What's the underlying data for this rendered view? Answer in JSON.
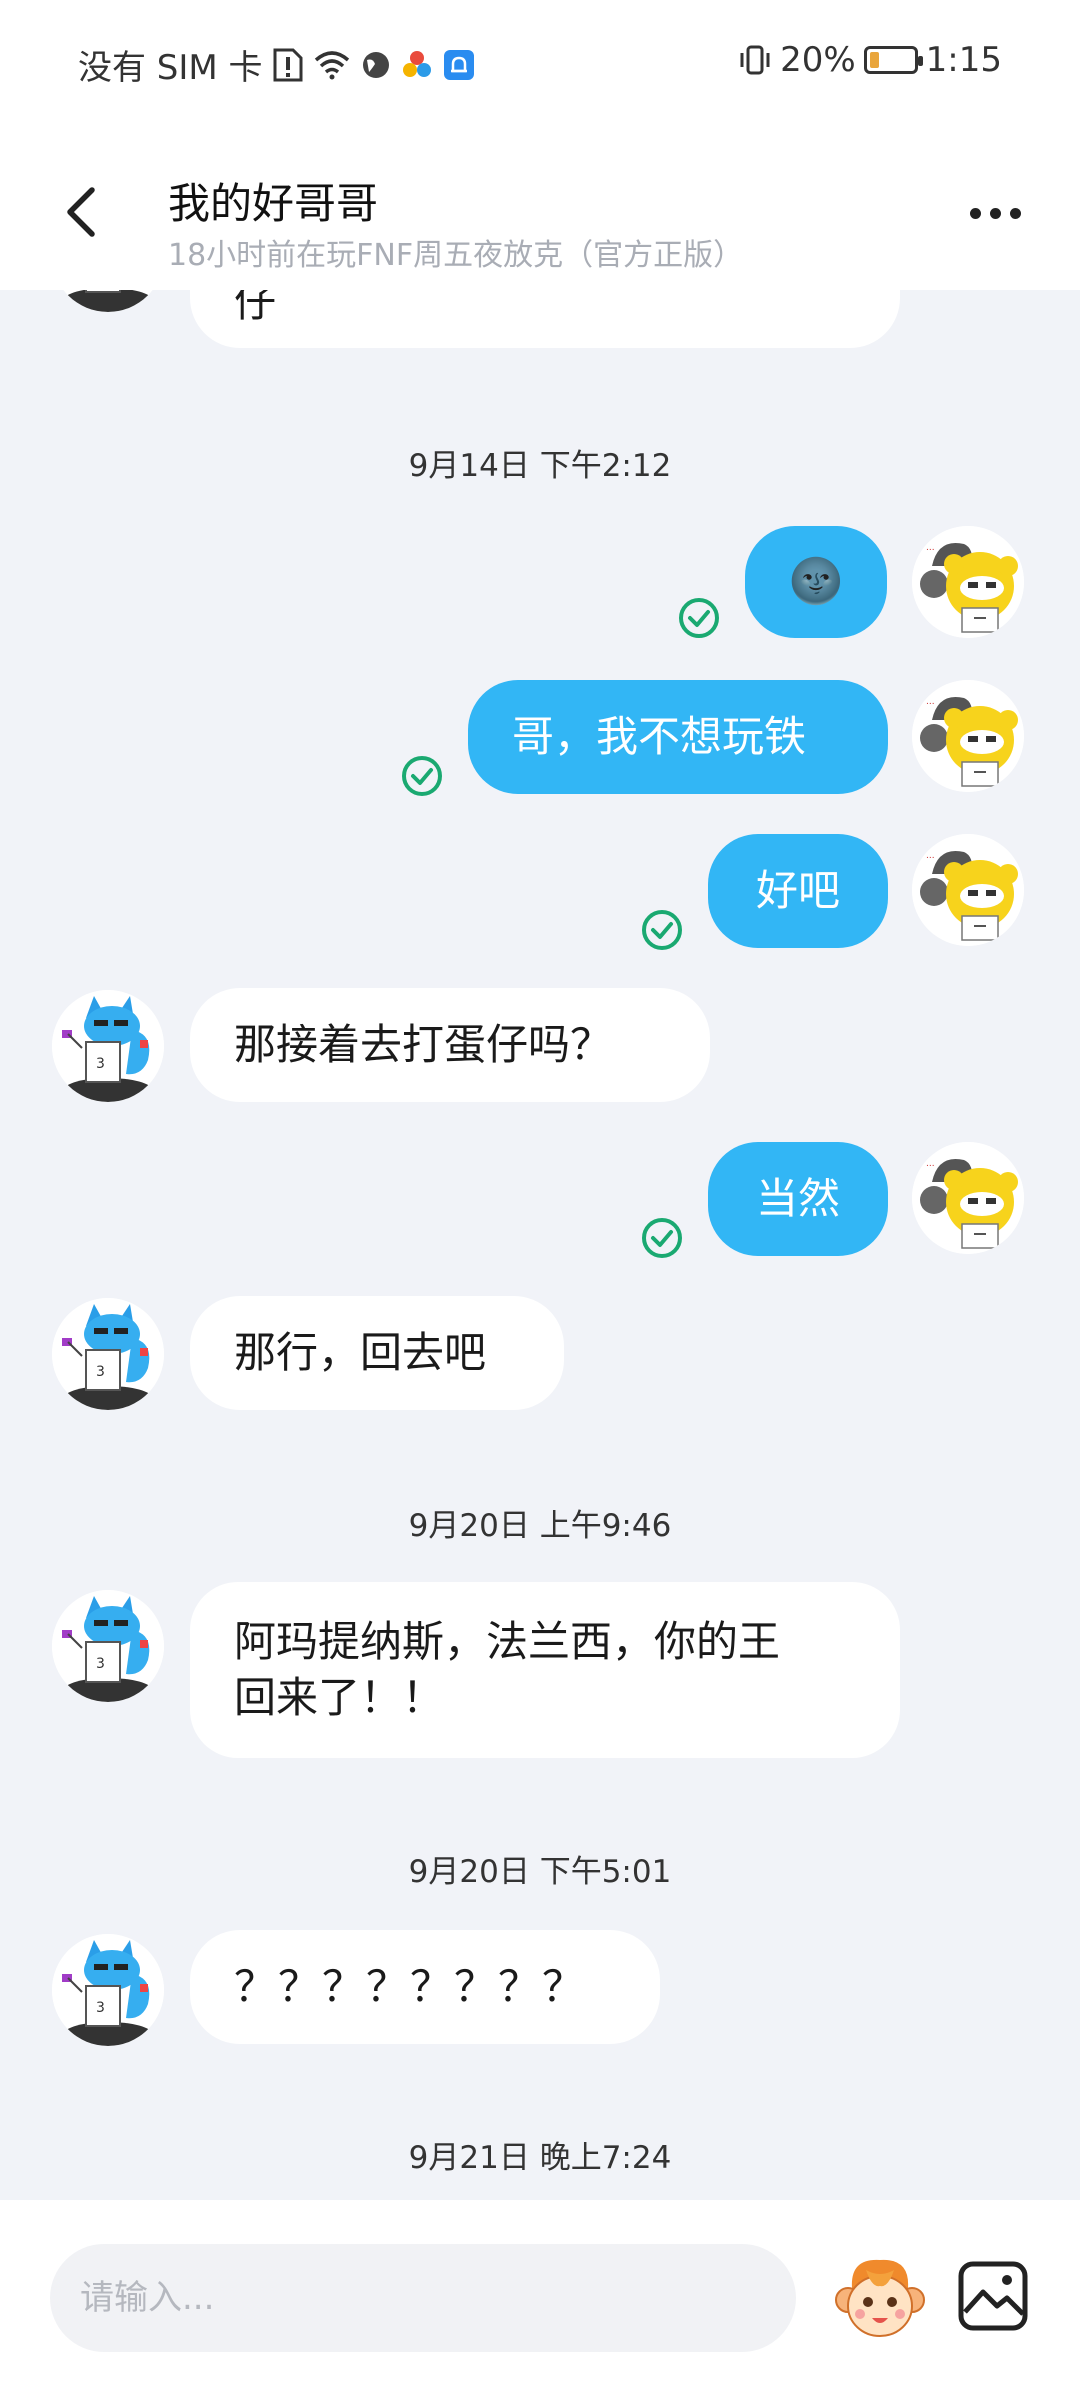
{
  "status_bar": {
    "carrier": "没有 SIM 卡",
    "battery": "20%",
    "battery_level": 0.2,
    "time": "1:15"
  },
  "header": {
    "title": "我的好哥哥",
    "subtitle": "18小时前在玩FNF周五夜放克（官方正版）"
  },
  "messages": [
    {
      "side": "in",
      "text": "仔",
      "partial": true
    },
    {
      "type": "timestamp",
      "text": "9月14日 下午2:12"
    },
    {
      "side": "out",
      "text": "🌚",
      "read": true
    },
    {
      "side": "out",
      "text": "哥，我不想玩铁",
      "read": true
    },
    {
      "side": "out",
      "text": "好吧",
      "read": true
    },
    {
      "side": "in",
      "text": "那接着去打蛋仔吗？"
    },
    {
      "side": "out",
      "text": "当然",
      "read": true
    },
    {
      "side": "in",
      "text": "那行，回去吧"
    },
    {
      "type": "timestamp",
      "text": "9月20日 上午9:46"
    },
    {
      "side": "in",
      "text_line1": "阿玛提纳斯，法兰西，你的王",
      "text_line2": "回来了！！"
    },
    {
      "type": "timestamp",
      "text": "9月20日 下午5:01"
    },
    {
      "side": "in",
      "text": "？？？？？？？？"
    },
    {
      "type": "timestamp",
      "text": "9月21日 晚上7:24"
    }
  ],
  "input_bar": {
    "placeholder": "请输入...",
    "emoji_icon": "monkey-emoji-icon",
    "image_icon": "image-icon"
  },
  "colors": {
    "outgoing_bubble": "#32b6f5",
    "incoming_bubble": "#ffffff",
    "chat_background": "#f1f3f8",
    "read_check": "#1aa971"
  }
}
